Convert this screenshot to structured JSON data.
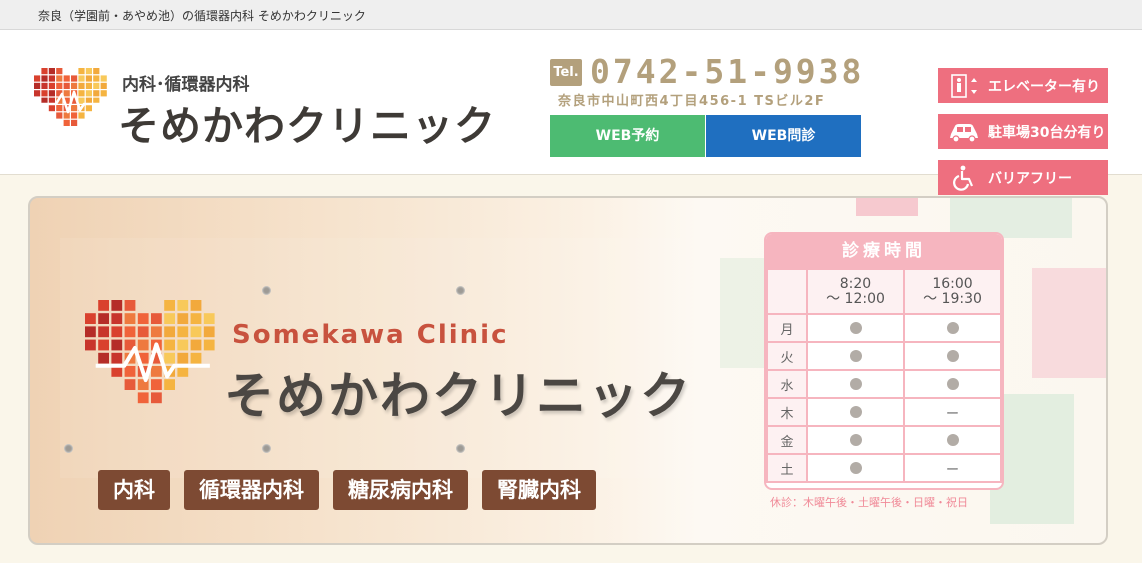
{
  "topbar": {
    "text": "奈良（学園前・あやめ池）の循環器内科 そめかわクリニック"
  },
  "header": {
    "logo_sub": "内科･循環器内科",
    "logo_name": "そめかわクリニック",
    "tel_badge": "Tel.",
    "tel_number": "0742-51-9938",
    "address": "奈良市中山町西4丁目456-1 TSビル2F",
    "web_reserve": "WEB予約",
    "web_consult": "WEB問診",
    "features": [
      {
        "icon": "elevator-icon",
        "label": "エレベーター有り"
      },
      {
        "icon": "car-icon",
        "label": "駐車場30台分有り"
      },
      {
        "icon": "wheelchair-icon",
        "label": "バリアフリー"
      }
    ]
  },
  "hero": {
    "en_name": "Somekawa Clinic",
    "ja_name": "そめかわクリニック",
    "tags": [
      "内科",
      "循環器内科",
      "糖尿病内科",
      "腎臓内科"
    ]
  },
  "schedule": {
    "title": "診療時間",
    "slots": [
      {
        "line1": "8:20",
        "line2": "〜 12:00"
      },
      {
        "line1": "16:00",
        "line2": "〜 19:30"
      }
    ],
    "rows": [
      {
        "day": "月",
        "am": "●",
        "pm": "●"
      },
      {
        "day": "火",
        "am": "●",
        "pm": "●"
      },
      {
        "day": "水",
        "am": "●",
        "pm": "●"
      },
      {
        "day": "木",
        "am": "●",
        "pm": "ー"
      },
      {
        "day": "金",
        "am": "●",
        "pm": "●"
      },
      {
        "day": "土",
        "am": "●",
        "pm": "ー"
      }
    ],
    "note": "休診：木曜午後・土曜午後・日曜・祝日"
  },
  "colors": {
    "accent_pink": "#ee6f7f",
    "gold": "#b3a07c",
    "green": "#4dbb72",
    "blue": "#1f6fc0",
    "brown": "#7d4a33"
  }
}
